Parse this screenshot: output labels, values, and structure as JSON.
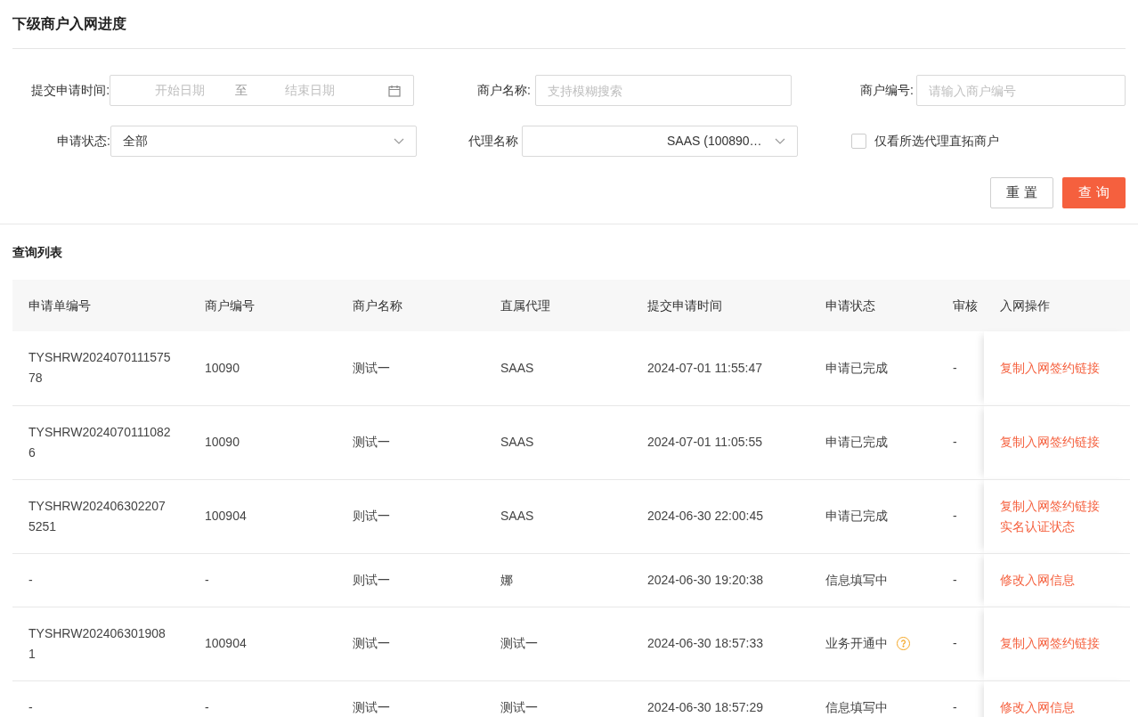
{
  "title": "下级商户入网进度",
  "filters": {
    "date": {
      "label": "提交申请时间:",
      "start_placeholder": "开始日期",
      "separator": "至",
      "end_placeholder": "结束日期"
    },
    "merchant_name": {
      "label": "商户名称:",
      "placeholder": "支持模糊搜索"
    },
    "merchant_no": {
      "label": "商户编号:",
      "placeholder": "请输入商户编号"
    },
    "status": {
      "label": "申请状态:",
      "value": "全部"
    },
    "agent": {
      "label": "代理名称",
      "value": "SAAS (100890…"
    },
    "direct_only": {
      "label": "仅看所选代理直拓商户",
      "checked": false
    }
  },
  "buttons": [
    {
      "label": "重 置",
      "kind": "secondary"
    },
    {
      "label": "查 询",
      "kind": "primary"
    }
  ],
  "list_title": "查询列表",
  "table": {
    "columns": [
      "申请单编号",
      "商户编号",
      "商户名称",
      "直属代理",
      "提交申请时间",
      "申请状态",
      "审核",
      "入网操作"
    ],
    "rows": [
      {
        "cells": [
          {
            "text": "TYSHRW202407011157578"
          },
          {
            "text": "10090"
          },
          {
            "text": "测试一"
          },
          {
            "text": "SAAS"
          },
          {
            "text": "2024-07-01 11:55:47"
          },
          {
            "text": "申请已完成"
          },
          {
            "text": "-"
          }
        ],
        "help": false,
        "actions": [
          "复制入网签约链接"
        ]
      },
      {
        "cells": [
          {
            "text": "TYSHRW20240701110826"
          },
          {
            "text": "10090"
          },
          {
            "text": "测试一"
          },
          {
            "text": "SAAS"
          },
          {
            "text": "2024-07-01 11:05:55"
          },
          {
            "text": "申请已完成"
          },
          {
            "text": "-"
          }
        ],
        "help": false,
        "actions": [
          "复制入网签约链接"
        ]
      },
      {
        "cells": [
          {
            "text": "TYSHRW2024063022075251"
          },
          {
            "text": "100904"
          },
          {
            "text": "则试一"
          },
          {
            "text": "SAAS"
          },
          {
            "text": "2024-06-30 22:00:45"
          },
          {
            "text": "申请已完成"
          },
          {
            "text": "-"
          }
        ],
        "help": false,
        "actions": [
          "复制入网签约链接",
          "实名认证状态"
        ]
      },
      {
        "cells": [
          {
            "text": "-"
          },
          {
            "text": "-"
          },
          {
            "text": "则试一"
          },
          {
            "text": "娜"
          },
          {
            "text": "2024-06-30 19:20:38"
          },
          {
            "text": "信息填写中"
          },
          {
            "text": "-"
          }
        ],
        "help": false,
        "actions": [
          "修改入网信息"
        ]
      },
      {
        "cells": [
          {
            "text": "TYSHRW2024063019081"
          },
          {
            "text": "100904"
          },
          {
            "text": "测试一"
          },
          {
            "text": "测试一"
          },
          {
            "text": "2024-06-30 18:57:33"
          },
          {
            "text": "业务开通中"
          },
          {
            "text": "-"
          }
        ],
        "help": true,
        "actions": [
          "复制入网签约链接"
        ]
      },
      {
        "cells": [
          {
            "text": "-"
          },
          {
            "text": "-"
          },
          {
            "text": "测试一"
          },
          {
            "text": "测试一"
          },
          {
            "text": "2024-06-30 18:57:29"
          },
          {
            "text": "信息填写中"
          },
          {
            "text": "-"
          }
        ],
        "help": false,
        "actions": [
          "修改入网信息"
        ]
      }
    ]
  }
}
